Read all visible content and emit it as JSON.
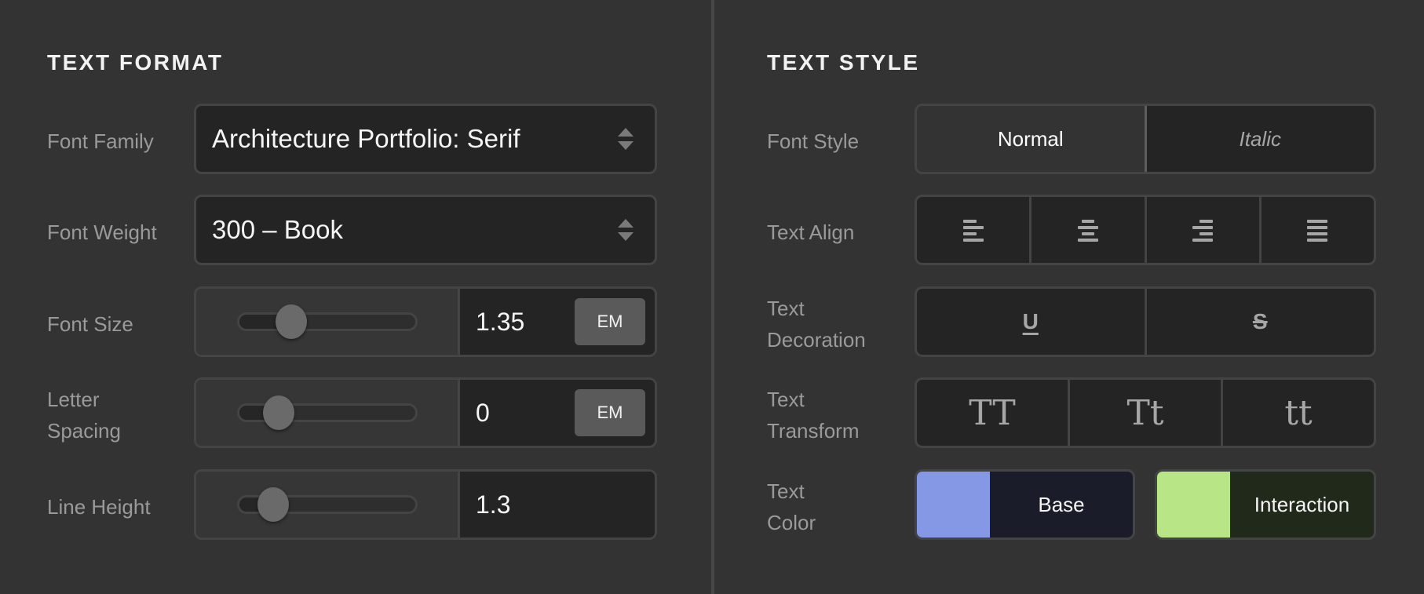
{
  "text_format": {
    "heading": "TEXT FORMAT",
    "font_family": {
      "label": "Font Family",
      "value": "Architecture Portfolio: Serif",
      "icon": "up-down-arrows-icon"
    },
    "font_weight": {
      "label": "Font Weight",
      "value": "300 – Book",
      "icon": "up-down-arrows-icon"
    },
    "font_size": {
      "label": "Font Size",
      "value": "1.35",
      "unit": "EM",
      "slider_fraction": 0.3
    },
    "letter_spacing": {
      "label_line1": "Letter",
      "label_line2": "Spacing",
      "value": "0",
      "unit": "EM",
      "slider_fraction": 0.23
    },
    "line_height": {
      "label": "Line Height",
      "value": "1.3",
      "slider_fraction": 0.2
    }
  },
  "text_style": {
    "heading": "TEXT STYLE",
    "font_style": {
      "label": "Font Style",
      "options": [
        "Normal",
        "Italic"
      ],
      "selected": "Normal"
    },
    "text_align": {
      "label": "Text Align",
      "options": [
        "align-left-icon",
        "align-center-icon",
        "align-right-icon",
        "align-justify-icon"
      ]
    },
    "text_decoration": {
      "label_line1": "Text",
      "label_line2": "Decoration",
      "options": [
        "underline-icon",
        "strikethrough-icon"
      ],
      "underline_glyph": "U",
      "strike_glyph": "S"
    },
    "text_transform": {
      "label_line1": "Text",
      "label_line2": "Transform",
      "options": [
        "TT",
        "Tt",
        "tt"
      ]
    },
    "text_color": {
      "label_line1": "Text",
      "label_line2": "Color",
      "base": {
        "name": "Base",
        "swatch": "#8598e6",
        "bg": "#1a1d29"
      },
      "interaction": {
        "name": "Interaction",
        "swatch": "#b8e686",
        "bg": "#21291a"
      }
    }
  }
}
